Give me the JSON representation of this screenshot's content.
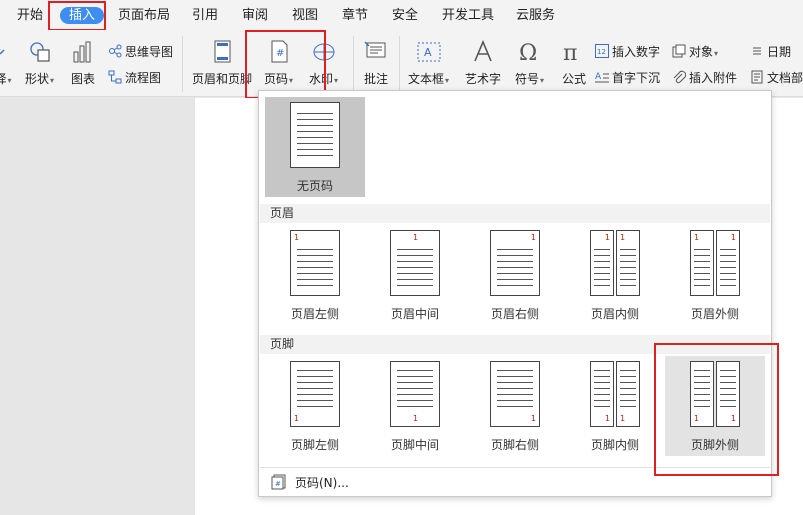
{
  "menubar": {
    "items": [
      "开始",
      "插入",
      "页面布局",
      "引用",
      "审阅",
      "视图",
      "章节",
      "安全",
      "开发工具",
      "云服务"
    ],
    "active": "插入"
  },
  "ribbon": {
    "partial_left": "择",
    "shapes": "形状",
    "chart": "图表",
    "mindmap": "思维导图",
    "flowchart": "流程图",
    "header_footer": "页眉和页脚",
    "page_number": "页码",
    "watermark": "水印",
    "comment": "批注",
    "textbox": "文本框",
    "wordart": "艺术字",
    "symbol": "符号",
    "formula": "公式",
    "insert_number": "插入数字",
    "drop_cap": "首字下沉",
    "object": "对象",
    "attachment": "插入附件",
    "date": "日期",
    "doc_part": "文档部"
  },
  "panel": {
    "no_page_number": "无页码",
    "header_section": "页眉",
    "footer_section": "页脚",
    "header_items": [
      "页眉左侧",
      "页眉中间",
      "页眉右侧",
      "页眉内侧",
      "页眉外侧"
    ],
    "footer_items": [
      "页脚左侧",
      "页脚中间",
      "页脚右侧",
      "页脚内侧",
      "页脚外侧"
    ],
    "page_number_dialog": "页码(N)...",
    "thumb_number": "1",
    "selected_item": "页脚外侧"
  },
  "colors": {
    "accent": "#3d8ef0",
    "highlight_border": "#e01f1f",
    "selected_bg": "#e3e3e3"
  }
}
